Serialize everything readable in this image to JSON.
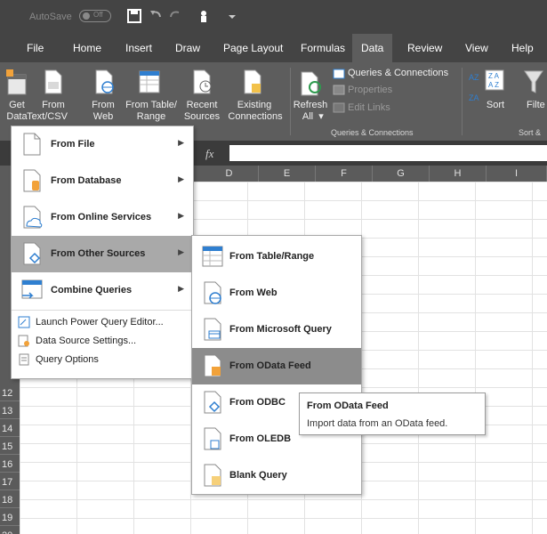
{
  "titlebar": {
    "autosave_label": "AutoSave",
    "autosave_state": "Off"
  },
  "tabs": [
    "File",
    "Home",
    "Insert",
    "Draw",
    "Page Layout",
    "Formulas",
    "Data",
    "Review",
    "View",
    "Help"
  ],
  "active_tab": "Data",
  "ribbon": {
    "get_data": "Get Data",
    "from_textcsv_1": "From",
    "from_textcsv_2": "Text/CSV",
    "from_web_1": "From",
    "from_web_2": "Web",
    "from_table_1": "From Table/",
    "from_table_2": "Range",
    "recent_sources_1": "Recent",
    "recent_sources_2": "Sources",
    "existing_connections_1": "Existing",
    "existing_connections_2": "Connections",
    "refresh_all_1": "Refresh",
    "refresh_all_2": "All",
    "queries_connections": "Queries & Connections",
    "properties": "Properties",
    "edit_links": "Edit Links",
    "queries_group_label": "Queries & Connections",
    "sort": "Sort",
    "filter": "Filte",
    "sort_group_label": "Sort &"
  },
  "formula_bar": {
    "fx": "fx"
  },
  "columns": [
    "D",
    "E",
    "F",
    "G",
    "H",
    "I"
  ],
  "rows": [
    "12",
    "13",
    "14",
    "15",
    "16",
    "17",
    "18",
    "19",
    "20"
  ],
  "menu": {
    "items": [
      {
        "label": "From File",
        "icon": "file-icon"
      },
      {
        "label": "From Database",
        "icon": "database-icon"
      },
      {
        "label": "From Online Services",
        "icon": "online-services-icon"
      },
      {
        "label": "From Other Sources",
        "icon": "other-sources-icon"
      },
      {
        "label": "Combine Queries",
        "icon": "combine-queries-icon"
      }
    ],
    "small_items": [
      {
        "label": "Launch Power Query Editor...",
        "icon": "power-query-icon"
      },
      {
        "label": "Data Source Settings...",
        "icon": "data-source-settings-icon"
      },
      {
        "label": "Query Options",
        "icon": "query-options-icon"
      }
    ]
  },
  "submenu": {
    "items": [
      {
        "label": "From Table/Range",
        "icon": "table-range-icon"
      },
      {
        "label": "From Web",
        "icon": "web-icon"
      },
      {
        "label": "From Microsoft Query",
        "icon": "microsoft-query-icon"
      },
      {
        "label": "From OData Feed",
        "icon": "odata-feed-icon"
      },
      {
        "label": "From ODBC",
        "icon": "odbc-icon"
      },
      {
        "label": "From OLEDB",
        "icon": "oledb-icon"
      },
      {
        "label": "Blank Query",
        "icon": "blank-query-icon"
      }
    ]
  },
  "tooltip": {
    "title": "From OData Feed",
    "description": "Import data from an OData feed."
  },
  "colors": {
    "title_bar": "#444444",
    "ribbon": "#5d5d5d",
    "menu_highlight": "#a9a9a9",
    "submenu_highlight": "#8c8c8c",
    "accent_orange": "#f2a23a",
    "accent_blue": "#2f7fd0"
  }
}
